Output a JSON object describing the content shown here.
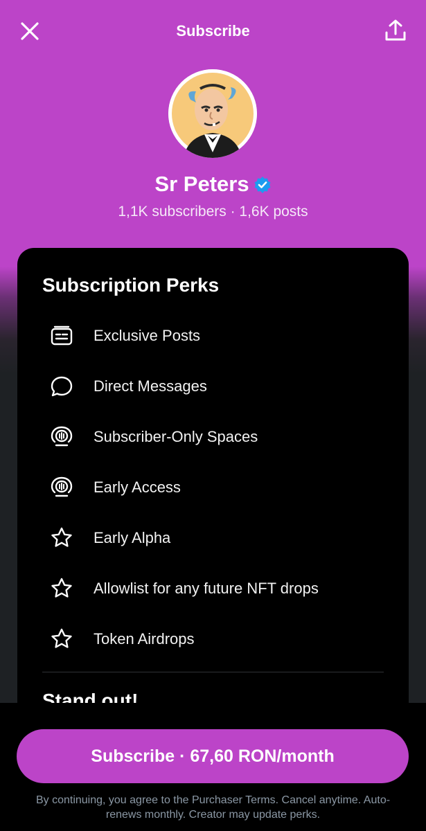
{
  "header": {
    "title": "Subscribe"
  },
  "profile": {
    "name": "Sr Peters",
    "stats": "1,1K subscribers · 1,6K posts",
    "verified": true,
    "verified_color": "#1d9bf0"
  },
  "perks": {
    "title": "Subscription Perks",
    "items": [
      {
        "icon": "posts-icon",
        "label": "Exclusive Posts"
      },
      {
        "icon": "message-bubble-icon",
        "label": "Direct Messages"
      },
      {
        "icon": "spaces-icon",
        "label": "Subscriber-Only Spaces"
      },
      {
        "icon": "spaces-icon",
        "label": "Early Access"
      },
      {
        "icon": "star-icon",
        "label": "Early Alpha"
      },
      {
        "icon": "star-icon",
        "label": "Allowlist for any future NFT drops"
      },
      {
        "icon": "star-icon",
        "label": "Token Airdrops"
      }
    ],
    "next_section_title": "Stand out!"
  },
  "footer": {
    "subscribe_label": "Subscribe · 67,60 RON/month",
    "legal": "By continuing, you agree to the Purchaser Terms. Cancel anytime. Auto-renews monthly. Creator may update perks."
  },
  "colors": {
    "accent": "#bc44c8",
    "card": "#000000",
    "background": "#1e2124"
  }
}
